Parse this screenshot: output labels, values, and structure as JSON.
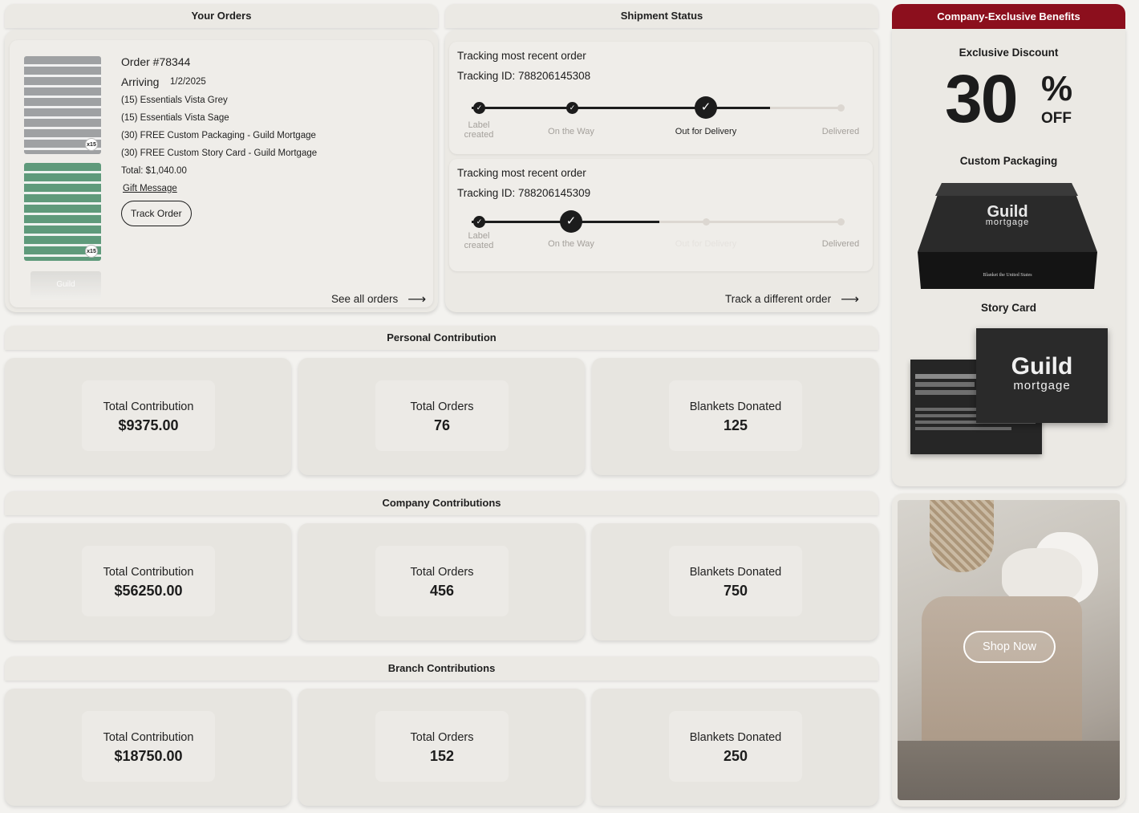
{
  "orders": {
    "header": "Your Orders",
    "order_number": "Order #78344",
    "arriving_label": "Arriving",
    "arriving_date": "1/2/2025",
    "items": [
      "(15) Essentials Vista Grey",
      "(15) Essentials Vista Sage",
      "(30) FREE Custom Packaging - Guild Mortgage",
      "(30) FREE Custom Story Card - Guild Mortgage"
    ],
    "total": "Total: $1,040.00",
    "gift_message": "Gift Message",
    "track_order": "Track Order",
    "see_all": "See all orders",
    "thumbs": [
      {
        "badge": "x15"
      },
      {
        "badge": "x15"
      },
      {
        "label": "Guild"
      }
    ]
  },
  "shipment": {
    "header": "Shipment Status",
    "trackers": [
      {
        "title": "Tracking most recent order",
        "tracking_id": "Tracking ID: 788206145308",
        "steps": [
          "Label created",
          "On the Way",
          "Out for Delivery",
          "Delivered"
        ],
        "progress_fraction": 0.82
      },
      {
        "title": "Tracking most recent order",
        "tracking_id": "Tracking ID: 788206145309",
        "steps": [
          "Label created",
          "On the Way",
          "Out for Delivery",
          "Delivered"
        ],
        "progress_fraction": 0.5
      }
    ],
    "track_different": "Track a different order"
  },
  "personal": {
    "header": "Personal Contribution",
    "stats": [
      {
        "label": "Total Contribution",
        "value": "$9375.00"
      },
      {
        "label": "Total Orders",
        "value": "76"
      },
      {
        "label": "Blankets Donated",
        "value": "125"
      }
    ]
  },
  "company": {
    "header": "Company Contributions",
    "stats": [
      {
        "label": "Total Contribution",
        "value": "$56250.00"
      },
      {
        "label": "Total Orders",
        "value": "456"
      },
      {
        "label": "Blankets Donated",
        "value": "750"
      }
    ]
  },
  "branch": {
    "header": "Branch Contributions",
    "stats": [
      {
        "label": "Total Contribution",
        "value": "$18750.00"
      },
      {
        "label": "Total Orders",
        "value": "152"
      },
      {
        "label": "Blankets Donated",
        "value": "250"
      }
    ]
  },
  "benefits": {
    "header": "Company-Exclusive Benefits",
    "discount_label": "Exclusive Discount",
    "discount_number": "30",
    "discount_percent": "%",
    "discount_off": "OFF",
    "packaging_label": "Custom Packaging",
    "packaging_brand": "Guild",
    "packaging_sub": "mortgage",
    "packaging_tagline": "Blanket the United States",
    "story_label": "Story Card",
    "story_brand": "Guild",
    "story_sub": "mortgage",
    "shop_now": "Shop Now"
  },
  "colors": {
    "accent": "#8c0f1d",
    "panel": "#ebe9e4",
    "dark": "#1c1c1c"
  }
}
